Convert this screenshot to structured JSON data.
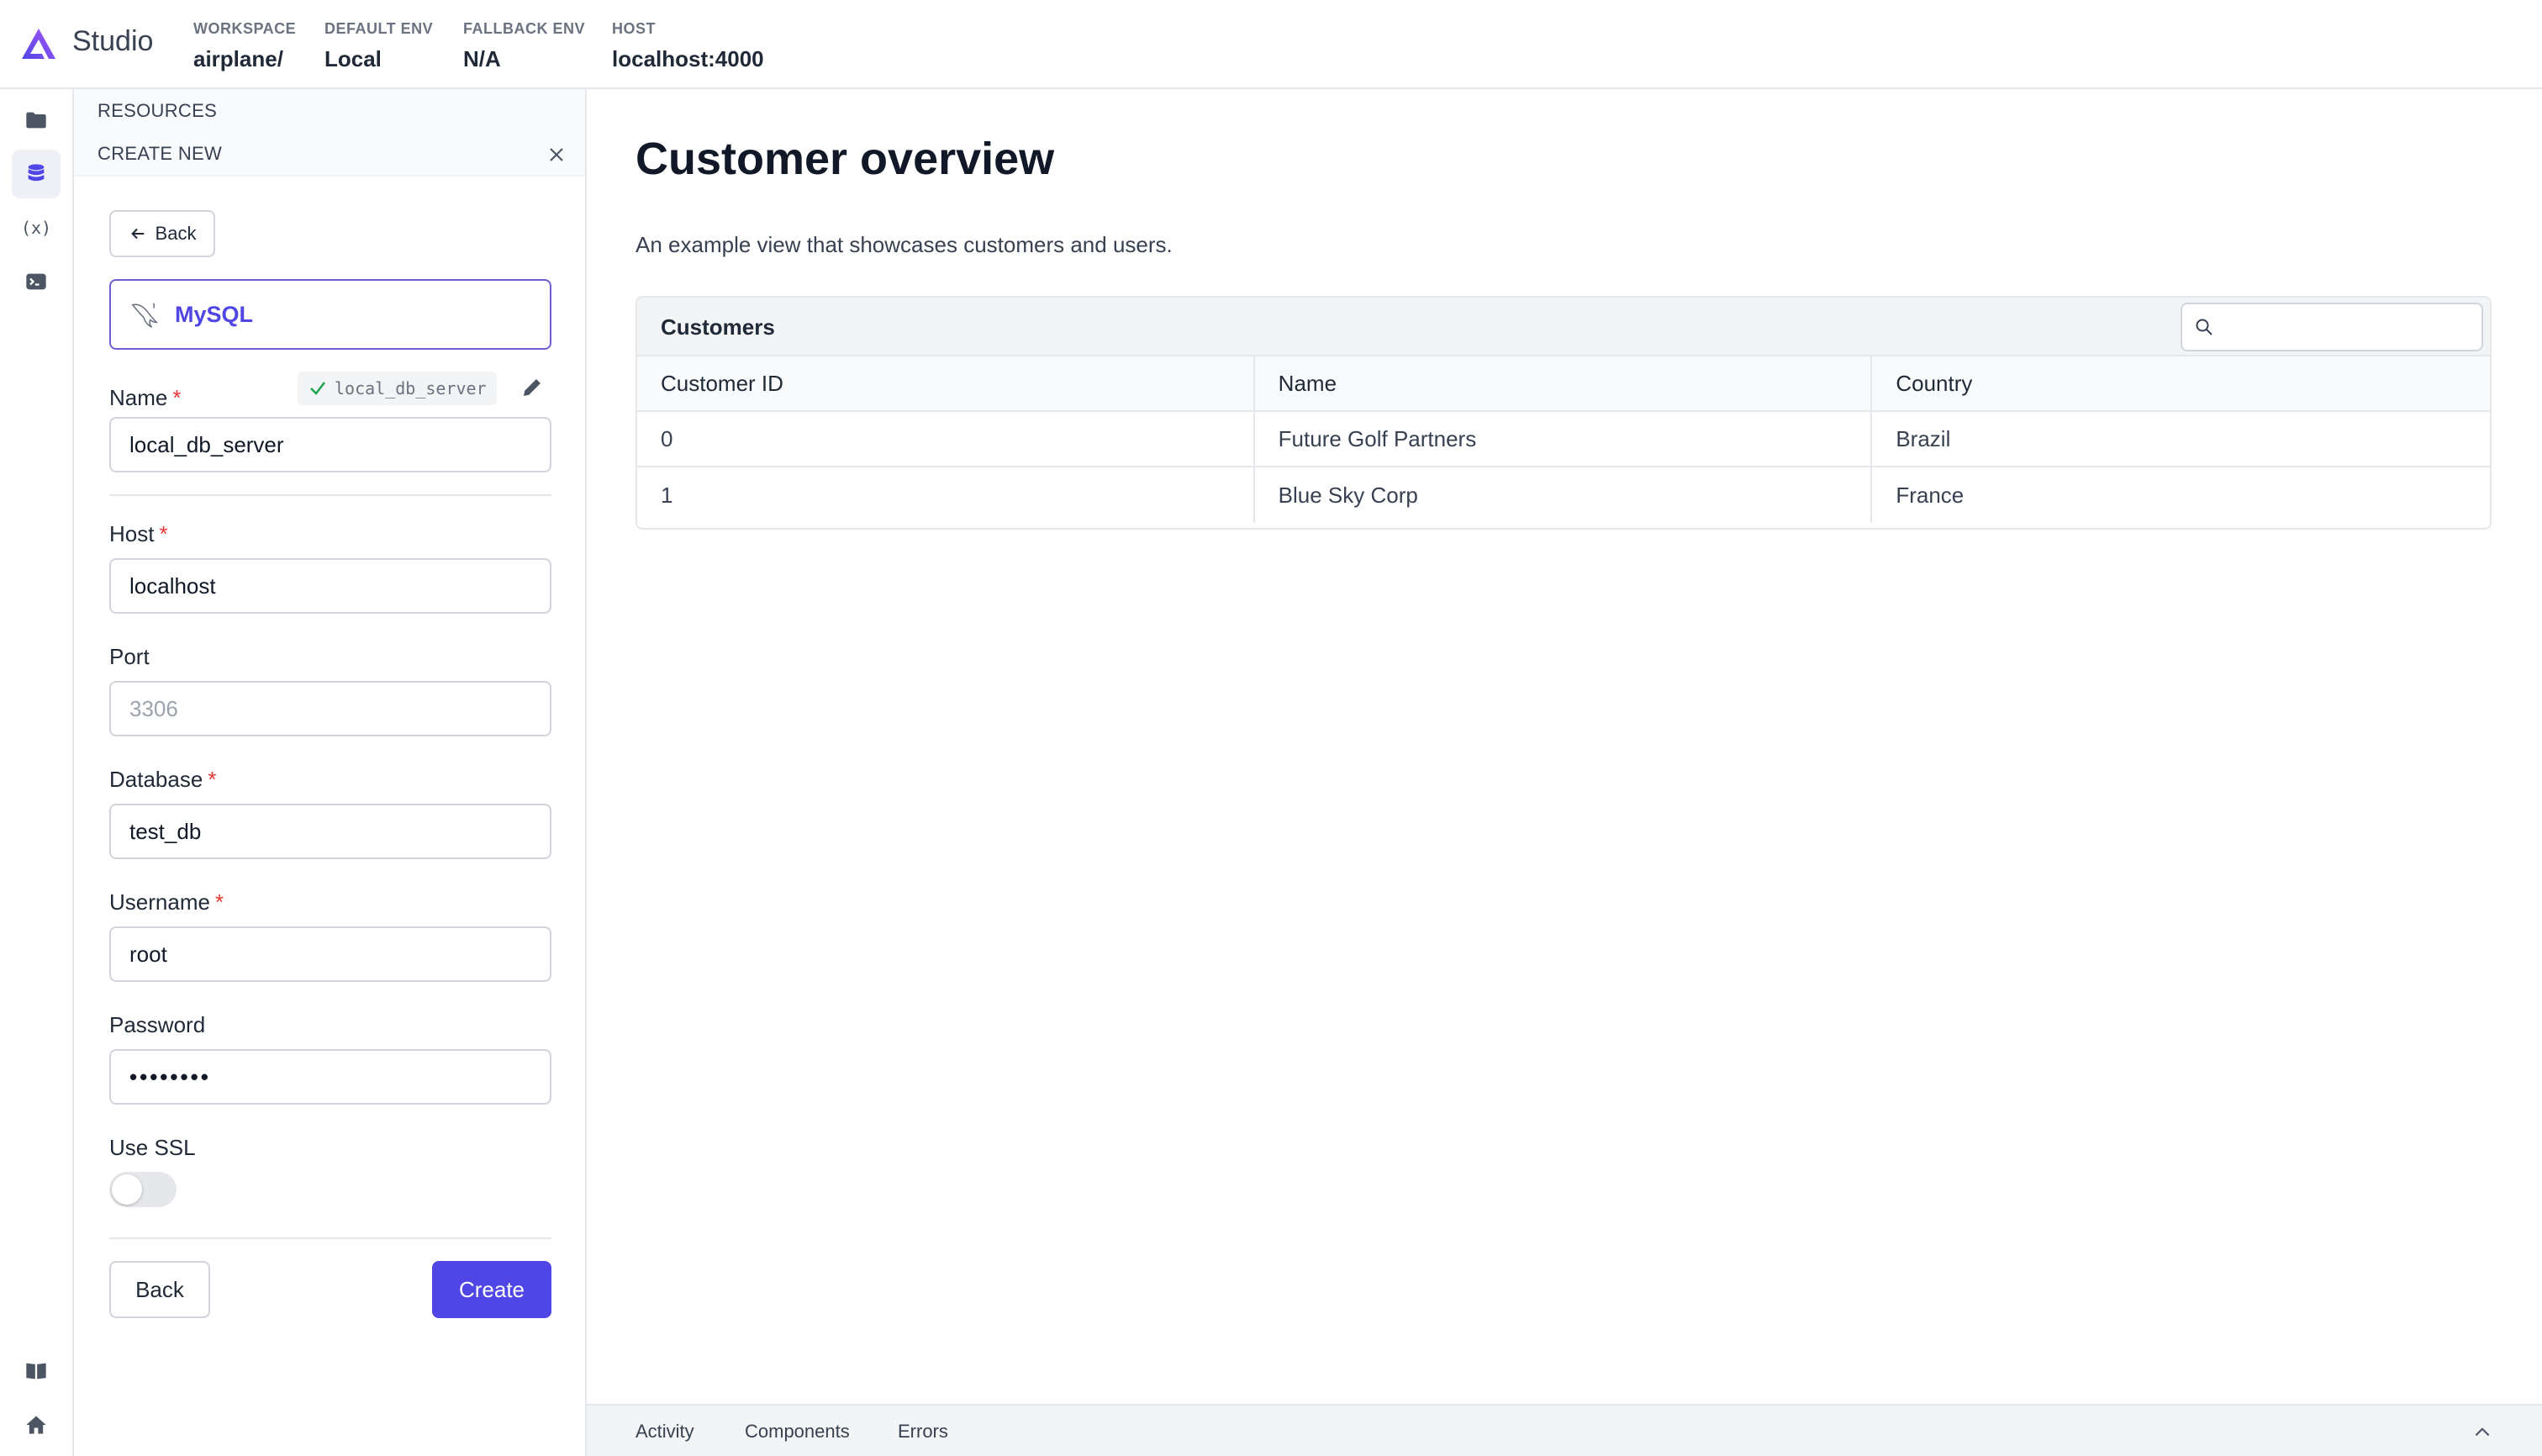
{
  "header": {
    "brand": "Studio",
    "workspace": {
      "label": "WORKSPACE",
      "value": "airplane/"
    },
    "default_env": {
      "label": "DEFAULT ENV",
      "value": "Local"
    },
    "fallback_env": {
      "label": "FALLBACK ENV",
      "value": "N/A"
    },
    "host": {
      "label": "HOST",
      "value": "localhost:4000"
    }
  },
  "rail": {
    "items": [
      "folder-icon",
      "database-icon",
      "variables-icon",
      "terminal-icon"
    ],
    "variables_text": "(x)",
    "bottom": [
      "book-icon",
      "home-icon"
    ]
  },
  "panel": {
    "resources_label": "RESOURCES",
    "create_new_label": "CREATE NEW",
    "back_label": "Back",
    "resource_type": "MySQL",
    "slug": "local_db_server",
    "fields": {
      "name": {
        "label": "Name",
        "value": "local_db_server",
        "required": true
      },
      "host": {
        "label": "Host",
        "value": "localhost",
        "required": true
      },
      "port": {
        "label": "Port",
        "placeholder": "3306",
        "required": false
      },
      "database": {
        "label": "Database",
        "value": "test_db",
        "required": true
      },
      "username": {
        "label": "Username",
        "value": "root",
        "required": true
      },
      "password": {
        "label": "Password",
        "value": "••••••••",
        "required": false
      },
      "use_ssl": {
        "label": "Use SSL",
        "enabled": false
      }
    },
    "required_mark": "*",
    "buttons": {
      "back": "Back",
      "create": "Create"
    }
  },
  "main": {
    "title": "Customer overview",
    "description": "An example view that showcases customers and users.",
    "table": {
      "title": "Customers",
      "search_placeholder": "",
      "columns": [
        "Customer ID",
        "Name",
        "Country"
      ],
      "rows": [
        [
          "0",
          "Future Golf Partners",
          "Brazil"
        ],
        [
          "1",
          "Blue Sky Corp",
          "France"
        ]
      ]
    }
  },
  "footer": {
    "tabs": [
      "Activity",
      "Components",
      "Errors"
    ]
  },
  "colors": {
    "accent": "#4f46e5",
    "required": "#e53935",
    "success": "#16a34a"
  }
}
